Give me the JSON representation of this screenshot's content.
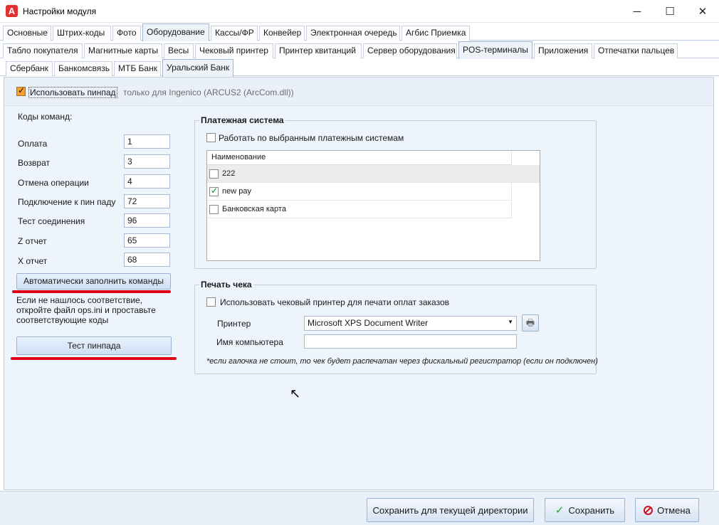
{
  "window": {
    "title": "Настройки модуля",
    "icon_letter": "A",
    "minimize_glyph": "─",
    "maximize_glyph": "☐",
    "close_glyph": "✕"
  },
  "tabs_level1": [
    "Основные",
    "Штрих-коды",
    "Фото",
    "Оборудование",
    "Кассы/ФР",
    "Конвейер",
    "Электронная очередь",
    "Агбис Приемка"
  ],
  "tabs_level1_active": "Оборудование",
  "tabs_level2": [
    "Табло покупателя",
    "Магнитные карты",
    "Весы",
    "Чековый принтер",
    "Принтер квитанций",
    "Сервер оборудования",
    "POS-терминалы",
    "Приложения",
    "Отпечатки пальцев"
  ],
  "tabs_level2_active": "POS-терминалы",
  "tabs_level3": [
    "Сбербанк",
    "Банкомсвязь",
    "МТБ Банк",
    "Уральский Банк"
  ],
  "tabs_level3_active": "Уральский Банк",
  "pinpad": {
    "use_label": "Использовать пинпад",
    "checked": true,
    "note": "только для Ingenico (ARCUS2 (ArcCom.dll))"
  },
  "commands": {
    "heading": "Коды команд:",
    "items": [
      {
        "label": "Оплата",
        "value": "1"
      },
      {
        "label": "Возврат",
        "value": "3"
      },
      {
        "label": "Отмена операции",
        "value": "4"
      },
      {
        "label": "Подключение к пин паду",
        "value": "72"
      },
      {
        "label": "Тест соединения",
        "value": "96"
      },
      {
        "label": "Z отчет",
        "value": "65"
      },
      {
        "label": "X отчет",
        "value": "68"
      }
    ],
    "autofill_button": "Автоматически заполнить команды",
    "hint": [
      "Если не нашлось соответствие,",
      "откройте файл ops.ini и проставьте",
      "соответствующие коды"
    ],
    "test_button": "Тест пинпада"
  },
  "payment_system": {
    "title": "Платежная система",
    "use_selected_label": "Работать по выбранным платежным системам",
    "use_selected_checked": false,
    "column_header": "Наименование",
    "rows": [
      {
        "name": "222",
        "checked": false
      },
      {
        "name": "new pay",
        "checked": true
      },
      {
        "name": "Банковская карта",
        "checked": false
      }
    ]
  },
  "receipt_print": {
    "title": "Печать чека",
    "use_printer_label": "Использовать чековый принтер для печати оплат заказов",
    "use_printer_checked": false,
    "printer_label": "Принтер",
    "printer_value": "Microsoft XPS Document Writer",
    "computer_label": "Имя компьютера",
    "computer_value": "",
    "footnote": "*если галочка не стоит, то чек будет распечатан через фискальный регистратор (если он подключен)"
  },
  "footer": {
    "save_dir_button": "Сохранить для текущей директории",
    "save_button": "Сохранить",
    "cancel_button": "Отмена"
  },
  "colors": {
    "accent_red": "#e00018",
    "check_orange": "#f0a030",
    "check_green": "#0a8a1a",
    "cancel_icon": "#d0101e"
  }
}
